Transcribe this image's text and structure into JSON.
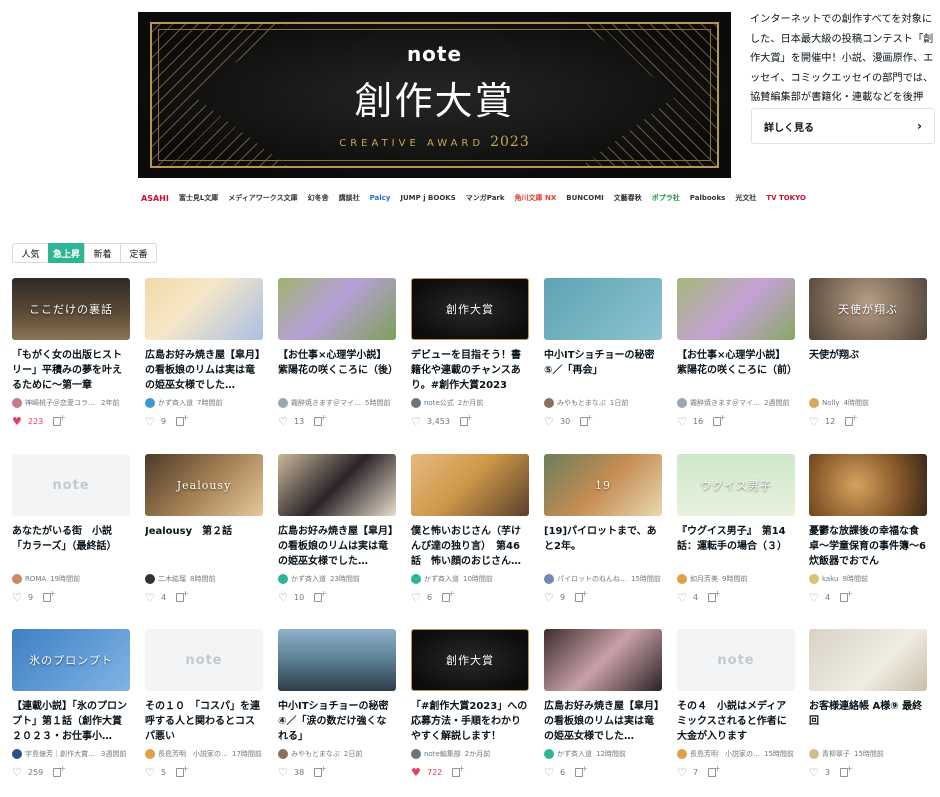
{
  "banner": {
    "brand": "note",
    "title": "創作大賞",
    "subtitle": "CREATIVE AWARD",
    "year": "2023",
    "sponsors": [
      "ASAHI",
      "富士見L文庫",
      "メディアワークス文庫",
      "幻冬舎",
      "講談社",
      "Palcy",
      "JUMP j BOOKS",
      "マンガPark",
      "角川文庫 NX",
      "BUNCOMI",
      "文藝春秋",
      "ポプラ社",
      "Palbooks",
      "光文社",
      "TV TOKYO"
    ]
  },
  "side": {
    "description": "インターネットでの創作すべてを対象にした、日本最大級の投稿コンテスト「創作大賞」を開催中！小説、漫画原作、エッセイ、コミックエッセイの部門では、協賛編集部が書籍化・連載などを後押し。応募締め切りは7/17(月)。",
    "detail_label": "詳しく見る"
  },
  "tabs": [
    {
      "label": "人気",
      "active": false
    },
    {
      "label": "急上昇",
      "active": true
    },
    {
      "label": "新着",
      "active": false
    },
    {
      "label": "定番",
      "active": false
    }
  ],
  "cards": [
    {
      "thumb_text": "ここだけの裏話",
      "title": "「もがく女の出版ヒストリー」平積みの夢を叶えるために〜第一章",
      "author": "神崎桃子＠恋愛コラム…",
      "time": "2年前",
      "likes": "223",
      "liked": true
    },
    {
      "thumb_text": "",
      "title": "広島お好み焼き屋【皐月】の看板娘のリムは実は竜の姫巫女様でした…",
      "author": "かず斉入道",
      "time": "7時間前",
      "likes": "9",
      "liked": false
    },
    {
      "thumb_text": "",
      "title": "【お仕事×心理学小説】紫陽花の咲くころに（後）",
      "author": "霧醉焼きます＠マイ…",
      "time": "5時間前",
      "likes": "13",
      "liked": false
    },
    {
      "thumb_text": "創作大賞",
      "title": "デビューを目指そう！書籍化や連載のチャンスあり。#創作大賞2023 募…",
      "author": "note公式",
      "time": "2か月前",
      "likes": "3,453",
      "liked": false
    },
    {
      "thumb_text": "",
      "title": "中小ITショチョーの秘密⑤／「再会」",
      "author": "みやもとまなぶ",
      "time": "1日前",
      "likes": "30",
      "liked": false
    },
    {
      "thumb_text": "",
      "title": "【お仕事×心理学小説】紫陽花の咲くころに（前）",
      "author": "霧醉焼きます＠マイ…",
      "time": "2週間前",
      "likes": "16",
      "liked": false
    },
    {
      "thumb_text": "天使が翔ぶ",
      "title": "天使が翔ぶ",
      "author": "Nolly",
      "time": "4時間前",
      "likes": "12",
      "liked": false
    },
    {
      "thumb_text": "note",
      "title": "あなたがいる街　小説「カラーズ」（最終話）",
      "author": "ROMA",
      "time": "19時間前",
      "likes": "9",
      "liked": false
    },
    {
      "thumb_text": "Jealousy",
      "title": "Jealousy　第２話",
      "author": "二木紘瑠",
      "time": "8時間前",
      "likes": "4",
      "liked": false
    },
    {
      "thumb_text": "",
      "title": "広島お好み焼き屋【皐月】の看板娘のリムは実は竜の姫巫女様でした…",
      "author": "かず斉入道",
      "time": "23時間前",
      "likes": "10",
      "liked": false
    },
    {
      "thumb_text": "",
      "title": "僕と怖いおじさん（芋けんぴ達の独り言）　第46話　怖い顔のおじさん…",
      "author": "かず斉入道",
      "time": "10時間前",
      "likes": "6",
      "liked": false
    },
    {
      "thumb_text": "19",
      "title": "[19]パイロットまで、あと2年。",
      "author": "パイロットのねんね…",
      "time": "15時間前",
      "likes": "9",
      "liked": false
    },
    {
      "thumb_text": "ウグイス男子",
      "title": "『ウグイス男子』　第14話：運転手の場合（３）",
      "author": "如月芳美",
      "time": "9時間前",
      "likes": "4",
      "liked": false
    },
    {
      "thumb_text": "",
      "title": "憂鬱な放課後の幸福な食卓〜学童保育の事件簿〜6 炊飯器でおでん",
      "author": "kaku",
      "time": "9時間前",
      "likes": "4",
      "liked": false
    },
    {
      "thumb_text": "氷のプロンプト",
      "title": "【連載小説】「氷のプロンプト」第１話（創作大賞２０２３・お仕事小…",
      "author": "宇島億芳｜創作大賞2…",
      "time": "3週間前",
      "likes": "259",
      "liked": false
    },
    {
      "thumb_text": "note",
      "title": "その１０　「コスパ」を連呼する人と関わるとコスパ悪い",
      "author": "長島芳明　小説家の…",
      "time": "17時間前",
      "likes": "5",
      "liked": false
    },
    {
      "thumb_text": "",
      "title": "中小ITショチョーの秘密④／「涙の数だけ強くなれる」",
      "author": "みやもとまなぶ",
      "time": "2日前",
      "likes": "38",
      "liked": false
    },
    {
      "thumb_text": "創作大賞",
      "title": "「#創作大賞2023」への応募方法・手順をわかりやすく解説します！",
      "author": "note編集部",
      "time": "2か月前",
      "likes": "722",
      "liked": true
    },
    {
      "thumb_text": "",
      "title": "広島お好み焼き屋【皐月】の看板娘のリムは実は竜の姫巫女様でした…",
      "author": "かず斉入道",
      "time": "12時間前",
      "likes": "6",
      "liked": false
    },
    {
      "thumb_text": "note",
      "title": "その４　小説はメディアミックスされると作者に大金が入ります",
      "author": "長島芳明　小説家の…",
      "time": "15時間前",
      "likes": "7",
      "liked": false
    },
    {
      "thumb_text": "",
      "title": "お客様連絡帳 A様⑨ 最終回",
      "author": "青柳翠子",
      "time": "15時間前",
      "likes": "3",
      "liked": false
    }
  ],
  "colors": {
    "accent": "#2cb696",
    "like": "#e4405f",
    "gold": "#b99650"
  }
}
